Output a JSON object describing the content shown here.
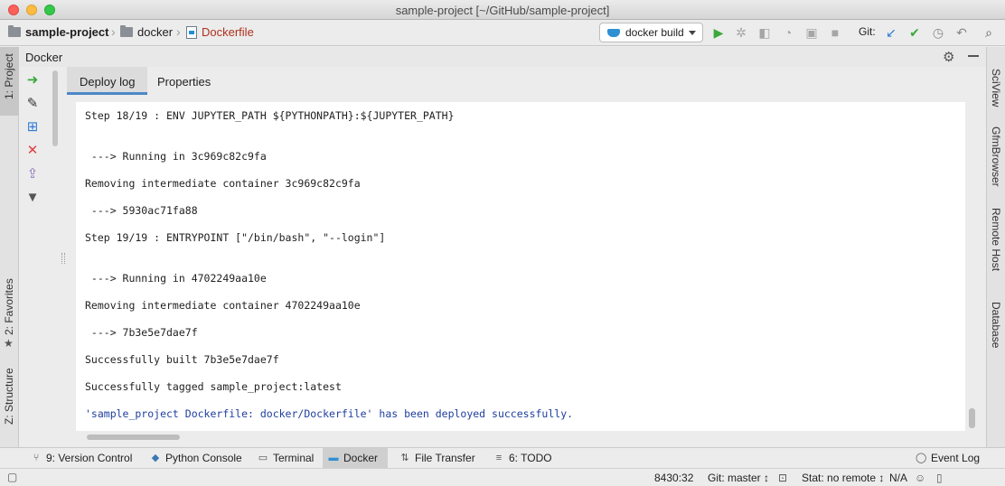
{
  "window": {
    "title": "sample-project [~/GitHub/sample-project]"
  },
  "breadcrumbs": [
    "sample-project",
    "docker",
    "Dockerfile"
  ],
  "run_config": {
    "label": "docker build"
  },
  "vcs": {
    "label": "Git:"
  },
  "left_stripe": {
    "project": "1: Project",
    "favorites": "2: Favorites",
    "structure": "Z: Structure"
  },
  "right_stripe": {
    "sciview": "SciView",
    "gfm": "GfmBrowser",
    "remote": "Remote Host",
    "database": "Database"
  },
  "tool_window": {
    "title": "Docker"
  },
  "tabs": [
    {
      "label": "Deploy log"
    },
    {
      "label": "Properties"
    }
  ],
  "log": [
    {
      "text": "Step 18/19 : ENV JUPYTER_PATH ${PYTHONPATH}:${JUPYTER_PATH}"
    },
    {
      "text": " ---> Running in 3c969c82c9fa"
    },
    {
      "text": "Removing intermediate container 3c969c82c9fa"
    },
    {
      "text": " ---> 5930ac71fa88"
    },
    {
      "text": "Step 19/19 : ENTRYPOINT [\"/bin/bash\", \"--login\"]"
    },
    {
      "text": " ---> Running in 4702249aa10e"
    },
    {
      "text": "Removing intermediate container 4702249aa10e"
    },
    {
      "text": " ---> 7b3e5e7dae7f"
    },
    {
      "text": "Successfully built 7b3e5e7dae7f"
    },
    {
      "text": "Successfully tagged sample_project:latest"
    },
    {
      "text": "'sample_project Dockerfile: docker/Dockerfile' has been deployed successfully."
    }
  ],
  "bottom_tabs": [
    {
      "label": "9: Version Control"
    },
    {
      "label": "Python Console"
    },
    {
      "label": "Terminal"
    },
    {
      "label": "Docker"
    },
    {
      "label": "File Transfer"
    },
    {
      "label": "6: TODO"
    },
    {
      "label": "Event Log"
    }
  ],
  "status": {
    "position": "8430:32",
    "branch": "Git: master ↕",
    "stat": "Stat: no remote ↕",
    "na": "N/A"
  },
  "colors": {
    "accent": "#4a88c7",
    "run_green": "#3aa83a",
    "info_text": "#1e3e9e",
    "stop_red": "#e04040"
  },
  "icons": [
    "run-icon",
    "debug-icon",
    "coverage-icon",
    "profile-icon",
    "concurrency-icon",
    "stop-icon",
    "git-update-icon",
    "git-commit-icon",
    "git-history-icon",
    "git-revert-icon",
    "search-icon"
  ]
}
